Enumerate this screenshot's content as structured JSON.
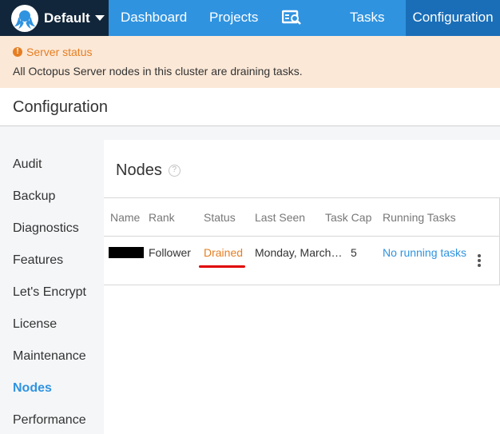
{
  "topnav": {
    "space": "Default",
    "links": {
      "dashboard": "Dashboard",
      "projects": "Projects",
      "infrastructure_icon": "server-search-icon",
      "tasks": "Tasks",
      "configuration": "Configuration"
    }
  },
  "alert": {
    "title": "Server status",
    "message": "All Octopus Server nodes in this cluster are draining tasks.",
    "icon": "warning-icon"
  },
  "page": {
    "title": "Configuration"
  },
  "sidebar": {
    "items": [
      "Audit",
      "Backup",
      "Diagnostics",
      "Features",
      "Let's Encrypt",
      "License",
      "Maintenance",
      "Nodes",
      "Performance"
    ],
    "active": "Nodes"
  },
  "nodes": {
    "title": "Nodes",
    "columns": [
      "Name",
      "Rank",
      "Status",
      "Last Seen",
      "Task Cap",
      "Running Tasks"
    ],
    "rows": [
      {
        "name": "",
        "rank": "Follower",
        "status": "Drained",
        "last_seen": "Monday, March…",
        "task_cap": "5",
        "running_tasks": "No running tasks"
      }
    ]
  },
  "colors": {
    "nav_blue": "#2f93e0",
    "nav_active": "#1a6eb8",
    "space_bg": "#11263a",
    "alert_bg": "#fbe8d7",
    "warning": "#e67e22",
    "highlight_red": "#e00000"
  }
}
